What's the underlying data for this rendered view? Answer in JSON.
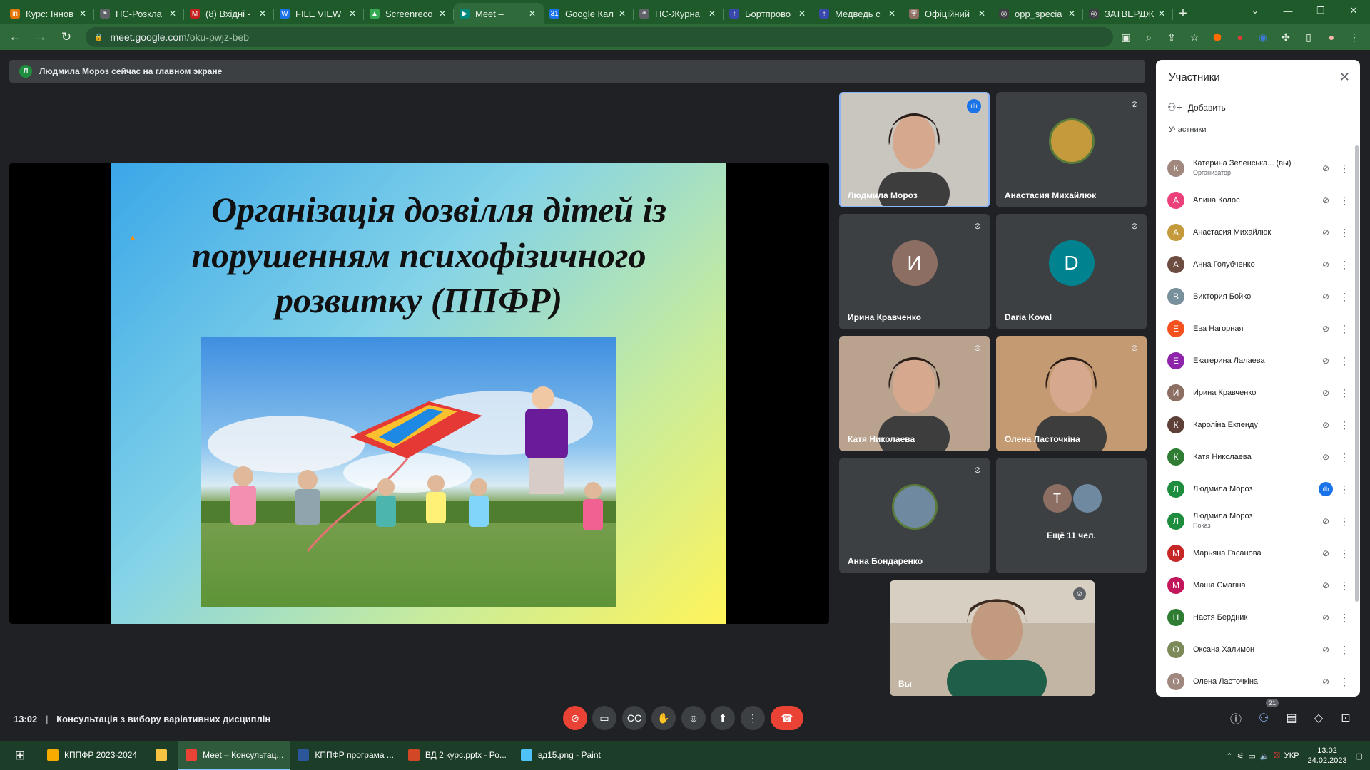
{
  "browser": {
    "tabs": [
      {
        "title": "Курс: Іннов",
        "icon": "in",
        "color": "#e37400"
      },
      {
        "title": "ПС-Розкла",
        "icon": "⚭",
        "color": "#5f6368"
      },
      {
        "title": "(8) Вхідні -",
        "icon": "M",
        "color": "#c5221f"
      },
      {
        "title": "FILE VIEW",
        "icon": "W",
        "color": "#1a73e8"
      },
      {
        "title": "Screenreco",
        "icon": "▲",
        "color": "#34a853"
      },
      {
        "title": "Meet –",
        "icon": "▶",
        "color": "#00897b"
      },
      {
        "title": "Google Кал",
        "icon": "31",
        "color": "#1a73e8"
      },
      {
        "title": "ПС-Журна",
        "icon": "⚭",
        "color": "#5f6368"
      },
      {
        "title": "Бортпрово",
        "icon": "↑",
        "color": "#3949ab"
      },
      {
        "title": "Медведь с",
        "icon": "↑",
        "color": "#3949ab"
      },
      {
        "title": "Офіційний",
        "icon": "⛨",
        "color": "#8d6e63"
      },
      {
        "title": "opp_specia",
        "icon": "◎",
        "color": "#3c4043"
      },
      {
        "title": "ЗАТВЕРДЖ",
        "icon": "◎",
        "color": "#3c4043"
      }
    ],
    "url_host": "meet.google.com",
    "url_path": "/oku-pwjz-beb"
  },
  "meet": {
    "banner_initial": "Л",
    "banner_text": "Людмила Мороз сейчас на главном экране",
    "slide_title_lines": [
      "Організація дозвілля дітей із",
      "порушенням психофізичного",
      "розвитку (ППФР)"
    ],
    "tiles": [
      {
        "name": "Людмила Мороз",
        "type": "video",
        "color": "#c9c6c0",
        "speaking": true
      },
      {
        "name": "Анастасия Михайлюк",
        "type": "photo",
        "color": "#c59a3c"
      },
      {
        "name": "Ирина Кравченко",
        "type": "letter",
        "letter": "И",
        "color": "#8d6e63"
      },
      {
        "name": "Daria Koval",
        "type": "letter",
        "letter": "D",
        "color": "#00838f"
      },
      {
        "name": "Катя Николаева",
        "type": "video",
        "color": "#b9a38f"
      },
      {
        "name": "Олена Ласточкіна",
        "type": "video",
        "color": "#c49a72"
      },
      {
        "name": "Анна Бондаренко",
        "type": "photo",
        "color": "#6f8aa0"
      },
      {
        "name": "Ещё 11 чел.",
        "type": "more",
        "letter": "T",
        "color": "#8d6e63"
      }
    ],
    "self_label": "Вы",
    "time": "13:02",
    "meeting_title": "Консультація з вибору варіативних дисциплін",
    "participant_count": "21"
  },
  "panel": {
    "title": "Участники",
    "add_label": "Добавить",
    "section_label": "Участники",
    "participants": [
      {
        "name": "Катерина Зеленська... (вы)",
        "sub": "Организатор",
        "initial": "К",
        "color": "#a1887f",
        "mic": "muted"
      },
      {
        "name": "Алина Колос",
        "sub": "",
        "initial": "А",
        "color": "#ec407a",
        "mic": "muted"
      },
      {
        "name": "Анастасия Михайлюк",
        "sub": "",
        "initial": "А",
        "color": "#c59a3c",
        "mic": "muted"
      },
      {
        "name": "Анна Голубченко",
        "sub": "",
        "initial": "А",
        "color": "#6d4c41",
        "mic": "muted"
      },
      {
        "name": "Виктория Бойко",
        "sub": "",
        "initial": "В",
        "color": "#78909c",
        "mic": "muted"
      },
      {
        "name": "Ева Нагорная",
        "sub": "",
        "initial": "Е",
        "color": "#f4511e",
        "mic": "muted"
      },
      {
        "name": "Екатерина Лалаева",
        "sub": "",
        "initial": "Е",
        "color": "#8e24aa",
        "mic": "muted"
      },
      {
        "name": "Ирина Кравченко",
        "sub": "",
        "initial": "И",
        "color": "#8d6e63",
        "mic": "muted"
      },
      {
        "name": "Кароліна Екпенду",
        "sub": "",
        "initial": "К",
        "color": "#5d4037",
        "mic": "muted"
      },
      {
        "name": "Катя Николаева",
        "sub": "",
        "initial": "К",
        "color": "#2e7d32",
        "mic": "muted"
      },
      {
        "name": "Людмила Мороз",
        "sub": "",
        "initial": "Л",
        "color": "#1e8e3e",
        "mic": "speaking"
      },
      {
        "name": "Людмила Мороз",
        "sub": "Показ",
        "initial": "Л",
        "color": "#1e8e3e",
        "mic": "present"
      },
      {
        "name": "Марьяна Гасанова",
        "sub": "",
        "initial": "М",
        "color": "#c62828",
        "mic": "muted"
      },
      {
        "name": "Маша Смагіна",
        "sub": "",
        "initial": "М",
        "color": "#c2185b",
        "mic": "muted"
      },
      {
        "name": "Настя Бердник",
        "sub": "",
        "initial": "Н",
        "color": "#2e7d32",
        "mic": "muted"
      },
      {
        "name": "Оксана Халимон",
        "sub": "",
        "initial": "О",
        "color": "#7c8a5a",
        "mic": "muted"
      },
      {
        "name": "Олена Ласточкіна",
        "sub": "",
        "initial": "О",
        "color": "#a1887f",
        "mic": "muted"
      }
    ]
  },
  "taskbar": {
    "apps": [
      {
        "label": "КППФР 2023-2024",
        "color": "#f9ab00",
        "active": false
      },
      {
        "label": "",
        "color": "#f6c343",
        "active": false
      },
      {
        "label": "Meet – Консультац...",
        "color": "#ea4335",
        "active": true
      },
      {
        "label": "КППФР програма ...",
        "color": "#2b579a",
        "active": false
      },
      {
        "label": "ВД 2 курс.pptx - Ро...",
        "color": "#d24726",
        "active": false
      },
      {
        "label": "вд15.png - Paint",
        "color": "#4fc3f7",
        "active": false
      }
    ],
    "lang": "УКР",
    "time": "13:02",
    "date": "24.02.2023"
  }
}
